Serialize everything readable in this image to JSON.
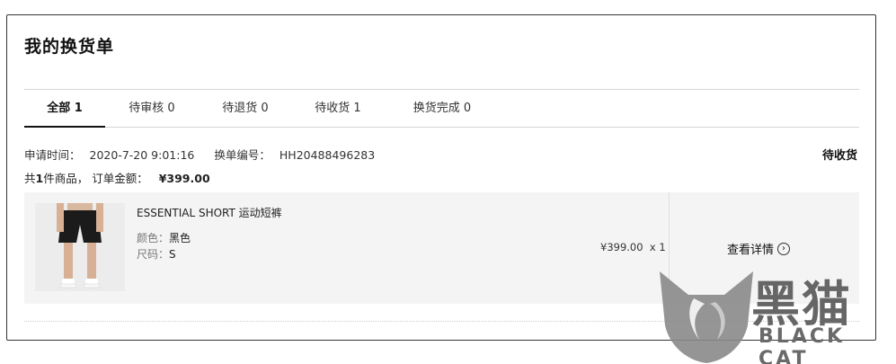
{
  "page": {
    "title": "我的换货单"
  },
  "tabs": [
    {
      "label": "全部 1",
      "active": true
    },
    {
      "label": "待审核 0",
      "active": false
    },
    {
      "label": "待退货 0",
      "active": false
    },
    {
      "label": "待收货 1",
      "active": false
    },
    {
      "label": "换货完成 0",
      "active": false
    }
  ],
  "order": {
    "apply_time_label": "申请时间：",
    "apply_time": "2020-7-20 9:01:16",
    "number_label": "换单编号：",
    "number": "HH20488496283",
    "status": "待收货",
    "summary_prefix": "共",
    "item_count": "1",
    "summary_middle": "件商品， 订单金额：",
    "amount": "¥399.00"
  },
  "product": {
    "name": "ESSENTIAL SHORT 运动短裤",
    "color_label": "颜色：",
    "color": "黑色",
    "size_label": "尺码：",
    "size": "S",
    "price_qty": "¥399.00  x 1",
    "detail_label": "查看详情",
    "image": "shorts-product-photo"
  },
  "watermark": {
    "cn": "黑猫",
    "en": "BLACK CAT"
  },
  "colors": {
    "accent": "#111111",
    "box_bg": "#f4f4f4",
    "border": "#333333"
  }
}
